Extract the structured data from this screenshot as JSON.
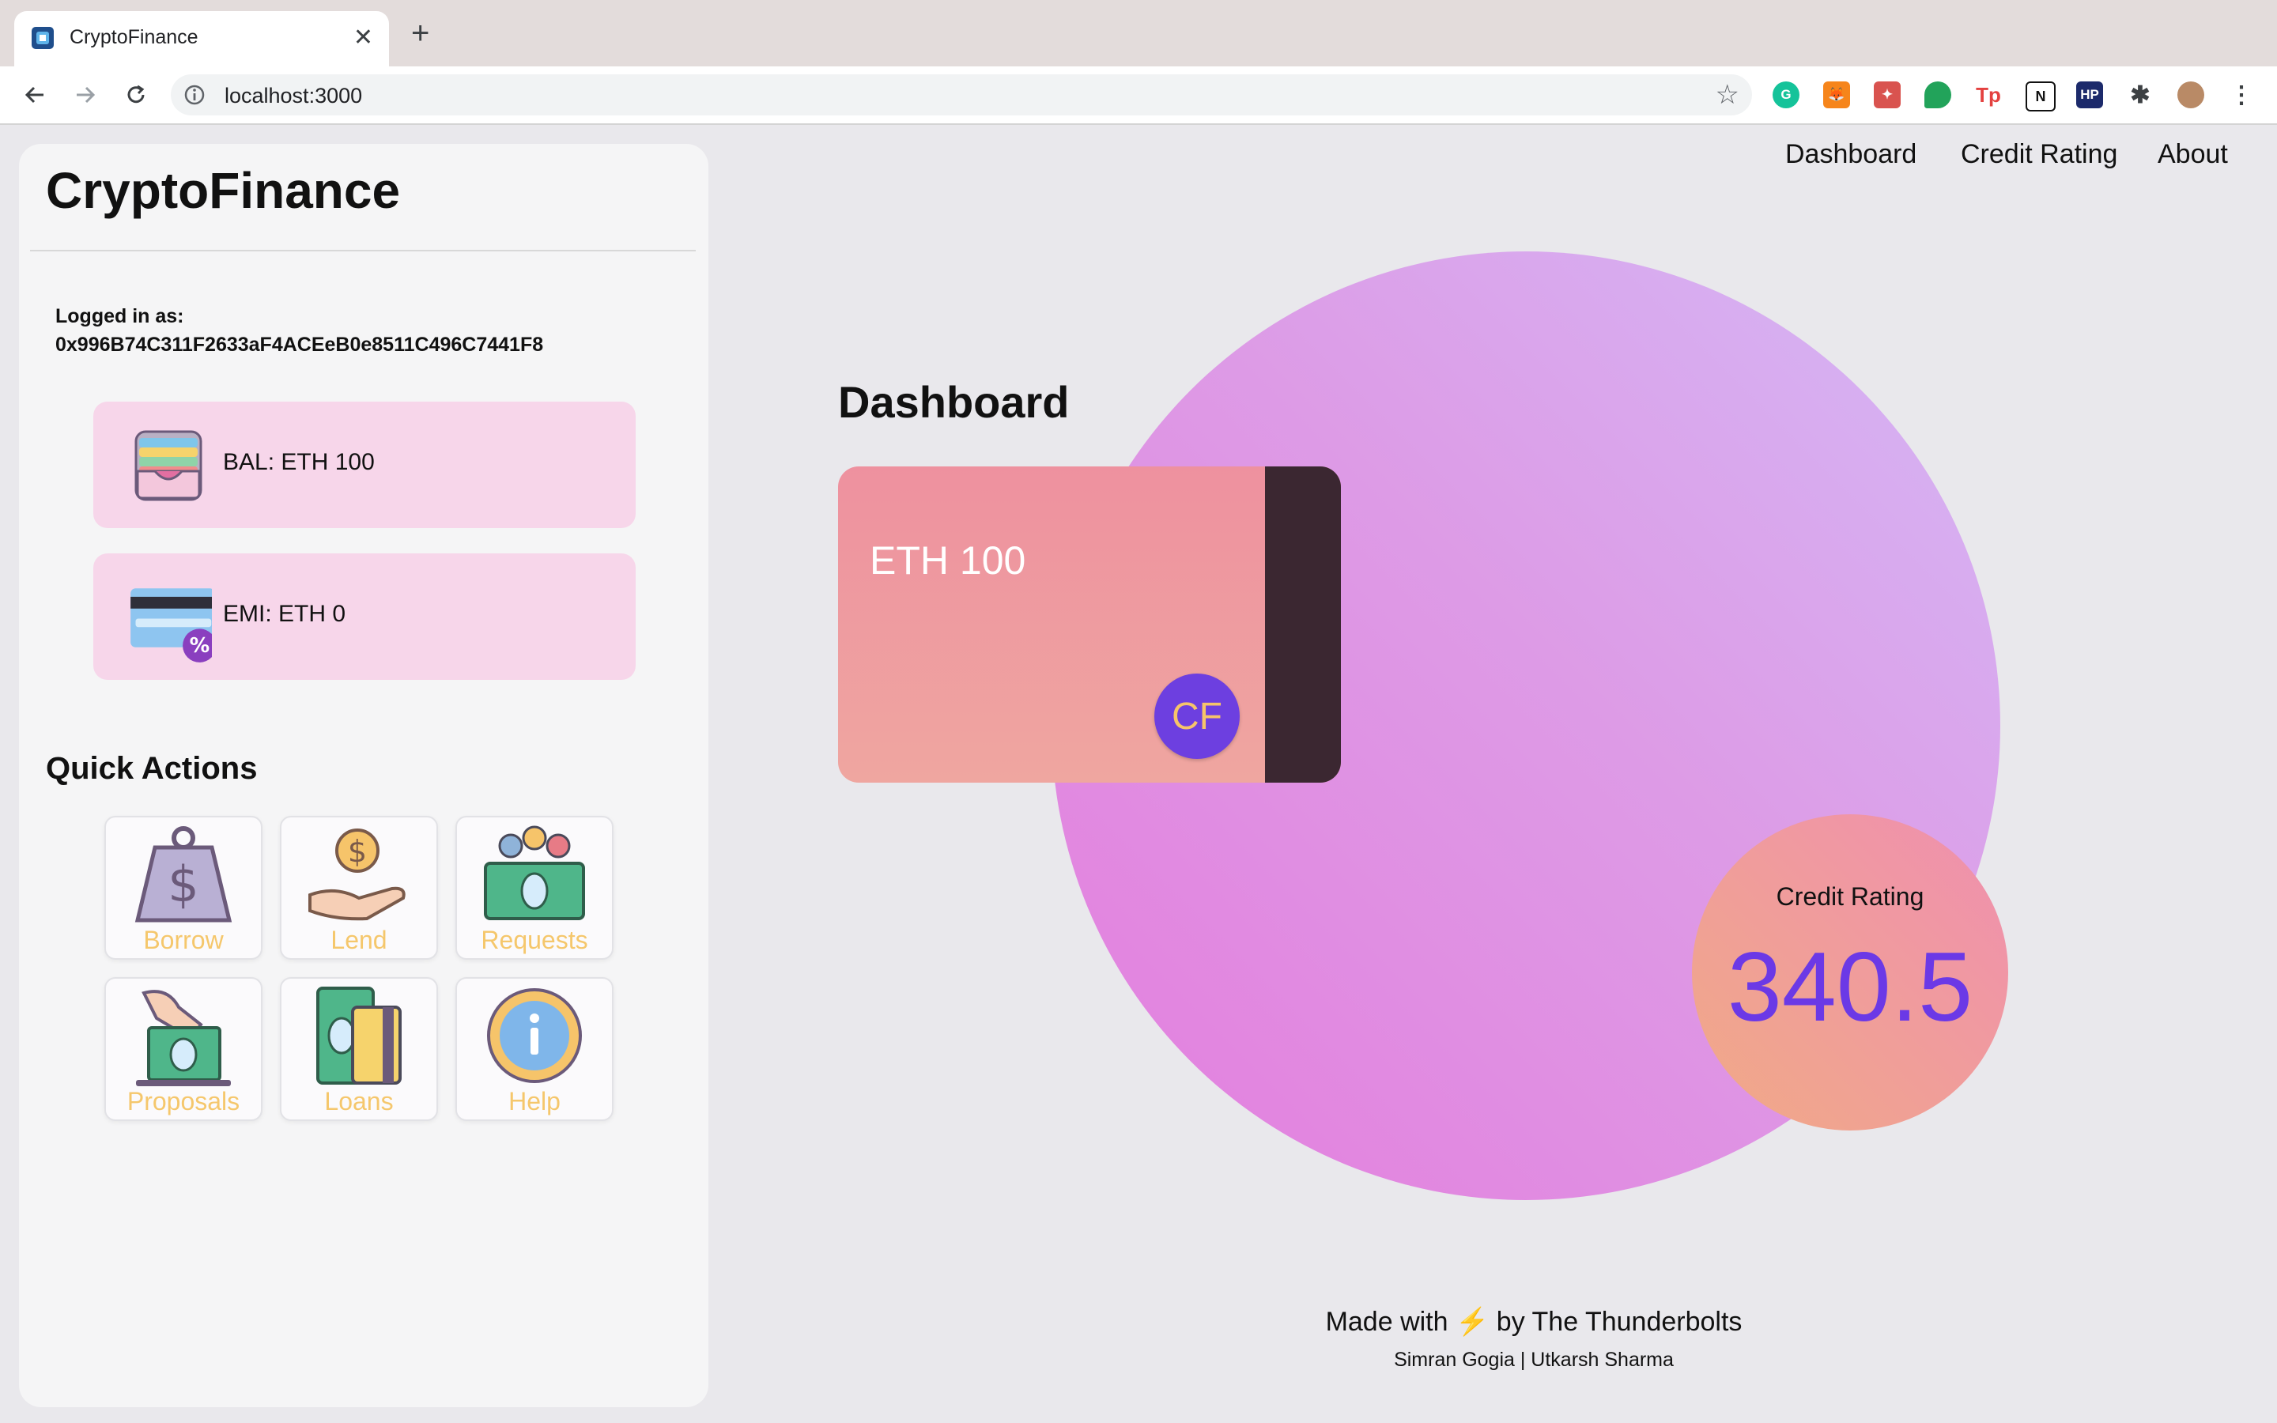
{
  "browser": {
    "tab_title": "CryptoFinance",
    "url": "localhost:3000",
    "extensions": [
      "grammarly-icon",
      "metamask-icon",
      "puzzle-game-icon",
      "speech-bubble-icon",
      "tp-icon",
      "notion-icon",
      "hp-icon",
      "extensions-puzzle-icon",
      "profile-avatar-icon",
      "menu-kebab-icon"
    ]
  },
  "nav": {
    "items": [
      "Dashboard",
      "Credit Rating",
      "About"
    ]
  },
  "sidebar": {
    "brand": "CryptoFinance",
    "logged_in_label": "Logged in as:",
    "address": "0x996B74C311F2633aF4ACEeB0e8511C496C7441F8",
    "balance_label": "BAL: ETH 100",
    "emi_label": "EMI: ETH 0",
    "quick_actions_title": "Quick Actions",
    "actions": [
      "Borrow",
      "Lend",
      "Requests",
      "Proposals",
      "Loans",
      "Help"
    ]
  },
  "main": {
    "title": "Dashboard",
    "card_amount": "ETH 100",
    "card_badge": "CF",
    "rating_label": "Credit Rating",
    "rating_value": "340.5"
  },
  "footer": {
    "made_with": "Made with",
    "bolt": "⚡",
    "by": "by The Thunderbolts",
    "authors": "Simran Gogia | Utkarsh Sharma"
  },
  "colors": {
    "accent_purple": "#6b39e6",
    "card_pink": "#ee919f",
    "stat_card_bg": "#f7d6ea",
    "action_label": "#f5c76c"
  }
}
